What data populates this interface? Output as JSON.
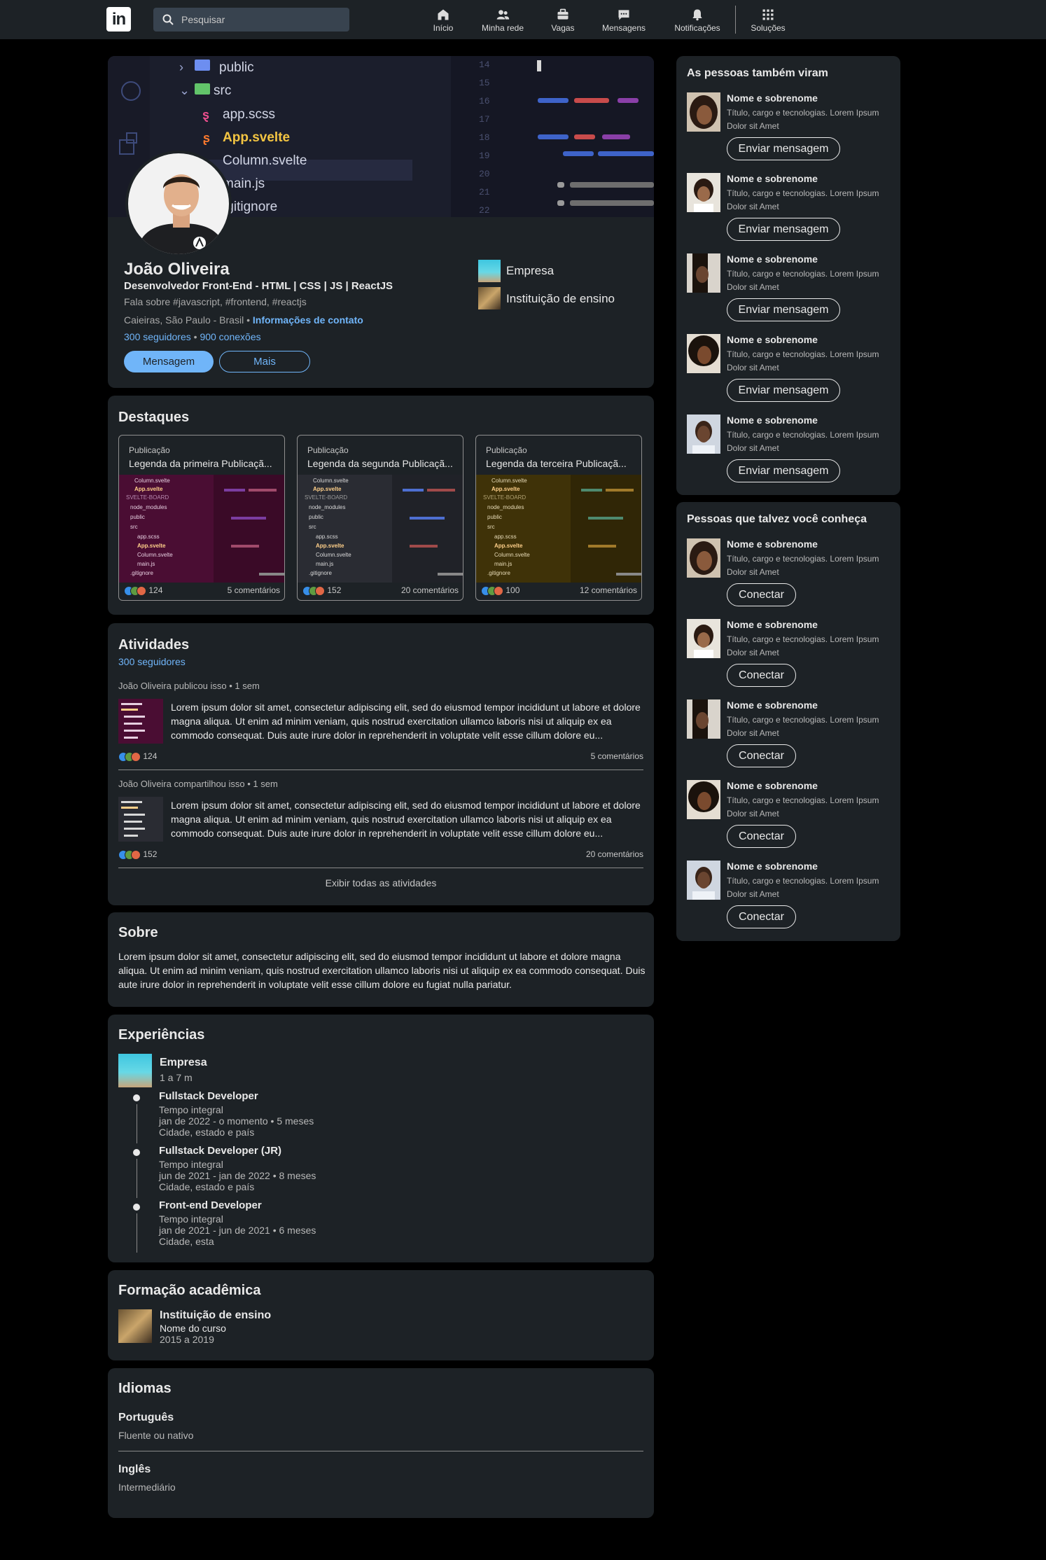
{
  "nav": {
    "search_placeholder": "Pesquisar",
    "items": [
      {
        "label": "Início",
        "icon": "home-icon"
      },
      {
        "label": "Minha rede",
        "icon": "network-icon"
      },
      {
        "label": "Vagas",
        "icon": "briefcase-icon"
      },
      {
        "label": "Mensagens",
        "icon": "messages-icon"
      },
      {
        "label": "Notificações",
        "icon": "bell-icon"
      },
      {
        "label": "Soluções",
        "icon": "grid-icon"
      }
    ]
  },
  "profile": {
    "name": "João Oliveira",
    "headline": "Desenvolvedor Front-End - HTML | CSS | JS | ReactJS",
    "about_short": "Fala sobre #javascript, #frontend, #reactjs",
    "location": "Caieiras, São Paulo - Brasil",
    "separator": "•",
    "contact_link": "Informações de contato",
    "followers": "300 seguidores",
    "connections": "900 conexões",
    "btn_message": "Mensagem",
    "btn_more": "Mais",
    "company": "Empresa",
    "school": "Instituição de ensino",
    "banner_files": [
      "public",
      "src",
      "app.scss",
      "App.svelte",
      "Column.svelte",
      "main.js",
      ".gitignore"
    ],
    "banner_lines": [
      "14",
      "15",
      "16",
      "17",
      "18",
      "19",
      "20",
      "21",
      "22"
    ]
  },
  "highlights": {
    "title": "Destaques",
    "items": [
      {
        "type": "Publicação",
        "caption": "Legenda da primeira Publicaçã...",
        "reactions": "124",
        "comments": "5 comentários",
        "tint": "#5a0f3c"
      },
      {
        "type": "Publicação",
        "caption": "Legenda da segunda Publicaçã...",
        "reactions": "152",
        "comments": "20 comentários",
        "tint": "#2b2d33"
      },
      {
        "type": "Publicação",
        "caption": "Legenda da terceira Publicaçã...",
        "reactions": "100",
        "comments": "12 comentários",
        "tint": "#4a3a08"
      }
    ]
  },
  "activities": {
    "title": "Atividades",
    "followers": "300 seguidores",
    "posts": [
      {
        "header": "João Oliveira publicou isso • 1 sem",
        "text": "Lorem ipsum dolor sit amet, consectetur adipiscing elit, sed do eiusmod tempor incididunt ut labore et dolore magna aliqua. Ut enim ad minim veniam, quis nostrud exercitation ullamco laboris nisi ut aliquip ex ea commodo consequat. Duis aute irure dolor in reprehenderit in voluptate velit esse cillum dolore eu...",
        "reactions": "124",
        "comments": "5 comentários"
      },
      {
        "header": "João Oliveira compartilhou isso • 1 sem",
        "text": "Lorem ipsum dolor sit amet, consectetur adipiscing elit, sed do eiusmod tempor incididunt ut labore et dolore magna aliqua. Ut enim ad minim veniam, quis nostrud exercitation ullamco laboris nisi ut aliquip ex ea commodo consequat. Duis aute irure dolor in reprehenderit in voluptate velit esse cillum dolore eu...",
        "reactions": "152",
        "comments": "20 comentários"
      }
    ],
    "show_all": "Exibir todas as atividades"
  },
  "about": {
    "title": "Sobre",
    "text": "Lorem ipsum dolor sit amet, consectetur adipiscing elit, sed do eiusmod tempor incididunt ut labore et dolore magna aliqua. Ut enim ad minim veniam, quis nostrud exercitation ullamco laboris nisi ut aliquip ex ea commodo consequat. Duis aute irure dolor in reprehenderit in voluptate velit esse cillum dolore eu fugiat nulla pariatur."
  },
  "experience": {
    "title": "Experiências",
    "company": "Empresa",
    "duration": "1 a 7 m",
    "roles": [
      {
        "title": "Fullstack Developer",
        "type": "Tempo integral",
        "period": "jan de 2022 - o momento • 5 meses",
        "location": "Cidade, estado e país"
      },
      {
        "title": "Fullstack Developer (JR)",
        "type": "Tempo integral",
        "period": "jun de 2021 - jan de 2022 • 8 meses",
        "location": "Cidade, estado e país"
      },
      {
        "title": "Front-end Developer",
        "type": "Tempo integral",
        "period": "jan de 2021 - jun de 2021 • 6 meses",
        "location": "Cidade, esta"
      }
    ]
  },
  "education": {
    "title": "Formação acadêmica",
    "school": "Instituição de ensino",
    "course": "Nome do curso",
    "years": "2015 a 2019"
  },
  "languages": {
    "title": "Idiomas",
    "items": [
      {
        "name": "Português",
        "level": "Fluente ou nativo"
      },
      {
        "name": "Inglês",
        "level": "Intermediário"
      }
    ]
  },
  "also_viewed": {
    "title": "As pessoas também viram",
    "button": "Enviar mensagem",
    "people": [
      {
        "name": "Nome e sobrenome",
        "desc": "Título, cargo e tecnologias. Lorem Ipsum Dolor sit Amet"
      },
      {
        "name": "Nome e sobrenome",
        "desc": "Título, cargo e tecnologias. Lorem Ipsum Dolor sit Amet"
      },
      {
        "name": "Nome e sobrenome",
        "desc": "Título, cargo e tecnologias. Lorem Ipsum Dolor sit Amet"
      },
      {
        "name": "Nome e sobrenome",
        "desc": "Título, cargo e tecnologias. Lorem Ipsum Dolor sit Amet"
      },
      {
        "name": "Nome e sobrenome",
        "desc": "Título, cargo e tecnologias. Lorem Ipsum Dolor sit Amet"
      }
    ]
  },
  "may_know": {
    "title": "Pessoas que talvez você conheça",
    "button": "Conectar",
    "people": [
      {
        "name": "Nome e sobrenome",
        "desc": "Título, cargo e tecnologias. Lorem Ipsum Dolor sit Amet"
      },
      {
        "name": "Nome e sobrenome",
        "desc": "Título, cargo e tecnologias. Lorem Ipsum Dolor sit Amet"
      },
      {
        "name": "Nome e sobrenome",
        "desc": "Título, cargo e tecnologias. Lorem Ipsum Dolor sit Amet"
      },
      {
        "name": "Nome e sobrenome",
        "desc": "Título, cargo e tecnologias. Lorem Ipsum Dolor sit Amet"
      },
      {
        "name": "Nome e sobrenome",
        "desc": "Título, cargo e tecnologias. Lorem Ipsum Dolor sit Amet"
      }
    ]
  },
  "colors": {
    "accent": "#70b5f9",
    "card": "#1d2226",
    "background": "#000000",
    "primary_button": "#70b5f9"
  }
}
